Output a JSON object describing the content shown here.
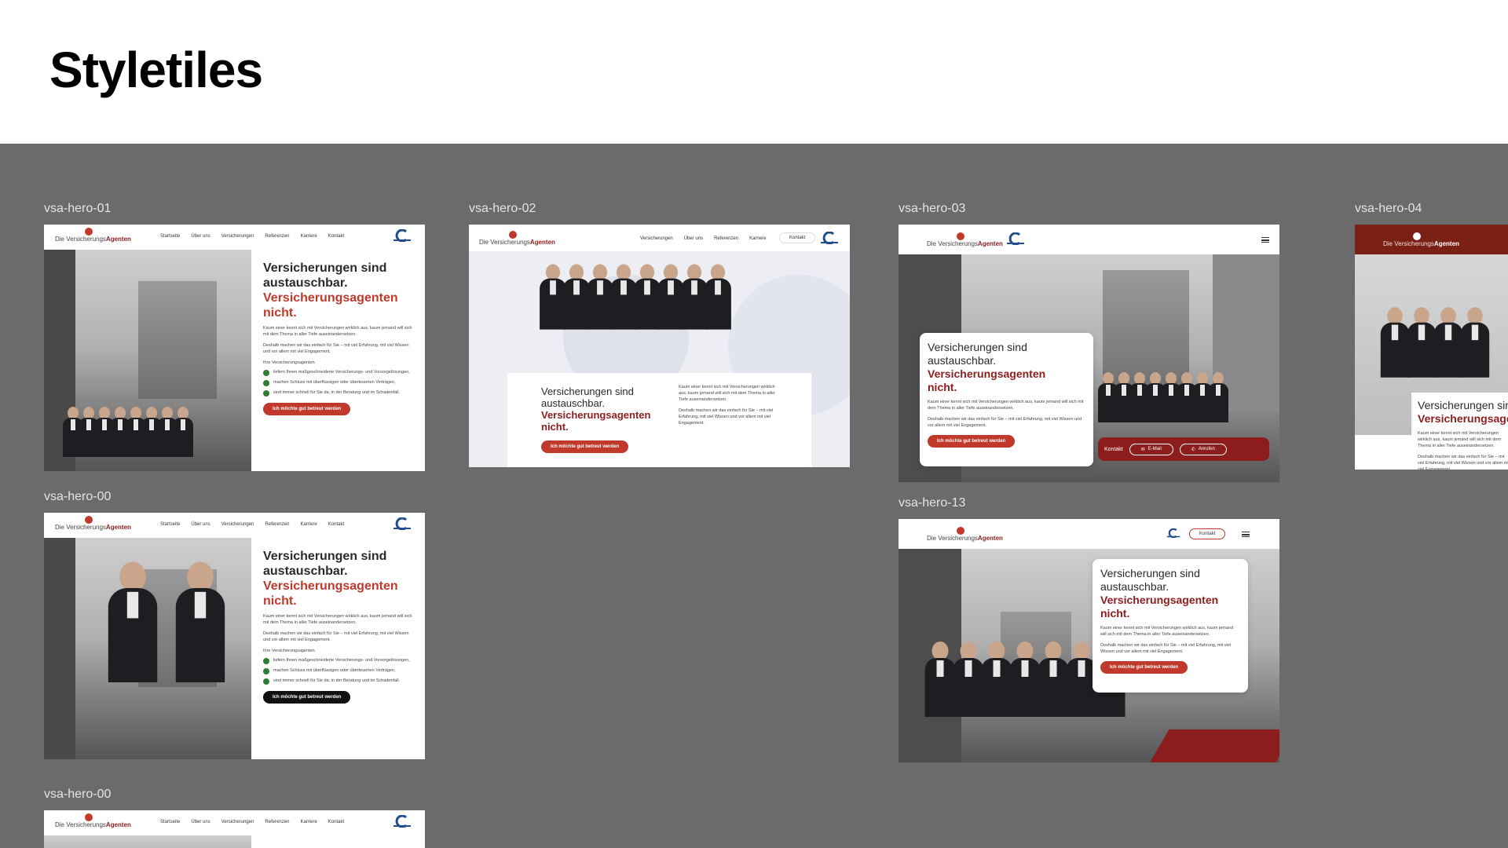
{
  "page": {
    "title": "Styletiles"
  },
  "brand": {
    "logo_prefix": "Die Versicherungs",
    "logo_suffix": "Agenten"
  },
  "nav": {
    "startseite": "Startseite",
    "ueber_uns": "Über uns",
    "versicherungen": "Versicherungen",
    "referenzen": "Referenzen",
    "karriere": "Karriere",
    "kontakt": "Kontakt"
  },
  "hero": {
    "title_line1": "Versicherungen sind",
    "title_line2": "austauschbar.",
    "title_accent1": "Versicherungsagenten",
    "title_accent2": "nicht.",
    "para1": "Kaum einer kennt sich mit Versicherungen wirklich aus, kaum jemand will sich mit dem Thema in aller Tiefe auseinandersetzen.",
    "para2": "Deshalb machen wir das einfach für Sie – mit viel Erfahrung, mit viel Wissen und vor allem mit viel Engagement.",
    "list_title": "Ihre Versicherungsagenten",
    "bullets": [
      "liefern Ihnen maßgeschneiderte Versicherungs- und Vorsorgelösungen,",
      "machen Schluss mit überflüssigen oder überteuerten Verträgen,",
      "sind immer schnell für Sie da, in der Beratung und im Schadenfall."
    ],
    "cta": "Ich möchte gut betreut werden"
  },
  "contact_bar": {
    "label": "Kontakt",
    "email": "E-Mail",
    "call": "Anrufen"
  },
  "frames": [
    {
      "label": "vsa-hero-01"
    },
    {
      "label": "vsa-hero-02"
    },
    {
      "label": "vsa-hero-03"
    },
    {
      "label": "vsa-hero-04"
    },
    {
      "label": "vsa-hero-00"
    },
    {
      "label": "vsa-hero-13"
    },
    {
      "label": "vsa-hero-00"
    }
  ],
  "colors": {
    "canvas": "#6b6b6b",
    "accent_red": "#c0392b",
    "dark_red": "#8b1d1d",
    "check_green": "#2e7d32"
  }
}
